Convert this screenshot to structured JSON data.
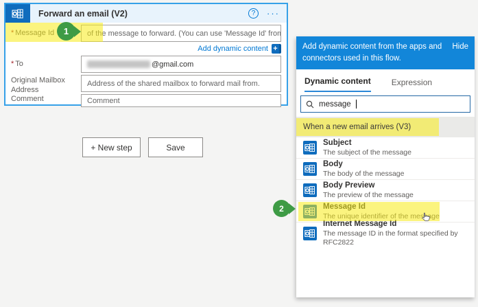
{
  "card": {
    "title": "Forward an email (V2)",
    "help_icon": "?",
    "more_icon": "···",
    "message_id": {
      "required": "*",
      "label": "Message Id",
      "value": "of the message to forward. (You can use 'Message Id' from trigger or 'Get En"
    },
    "add_dynamic_content": {
      "label": "Add dynamic content",
      "icon": "+"
    },
    "to": {
      "required": "*",
      "label": "To",
      "value_suffix": "@gmail.com"
    },
    "original_mailbox": {
      "label": "Original Mailbox Address",
      "placeholder": "Address of the shared mailbox to forward mail from."
    },
    "comment": {
      "label": "Comment",
      "placeholder": "Comment"
    }
  },
  "buttons": {
    "new_step": "+ New step",
    "save": "Save"
  },
  "panel": {
    "header_text": "Add dynamic content from the apps and connectors used in this flow.",
    "hide_label": "Hide",
    "tabs": {
      "dynamic": "Dynamic content",
      "expression": "Expression"
    },
    "search": {
      "value": "message"
    },
    "section_header": "When a new email arrives (V3)",
    "items": [
      {
        "title": "Subject",
        "desc": "The subject of the message"
      },
      {
        "title": "Body",
        "desc": "The body of the message"
      },
      {
        "title": "Body Preview",
        "desc": "The preview of the message"
      },
      {
        "title": "Message Id",
        "desc": "The unique identifier of the message"
      },
      {
        "title": "Internet Message Id",
        "desc": "The message ID in the format specified by RFC2822"
      }
    ]
  },
  "badges": {
    "step1": "1",
    "step2": "2"
  },
  "colors": {
    "accent_blue": "#1286d9",
    "link_blue": "#0078d4",
    "card_border": "#35a0e8",
    "highlight_yellow": "#f8eb16",
    "badge_green": "#3e9b45",
    "outlook_icon": "#0f6cbd"
  }
}
